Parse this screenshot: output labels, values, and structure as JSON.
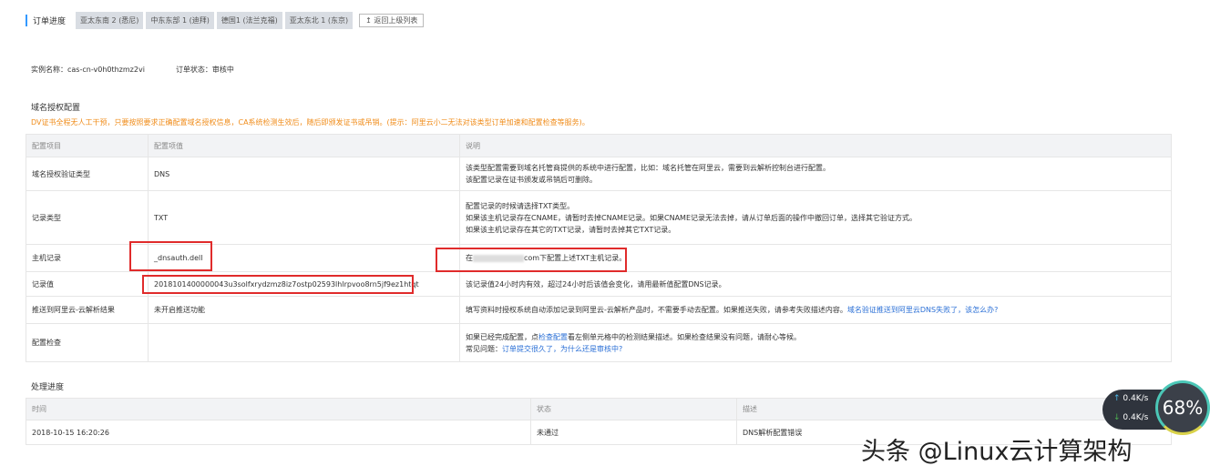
{
  "tabs": {
    "title": "订单进度",
    "items": [
      "亚太东南 2 (悉尼)",
      "中东东部 1 (迪拜)",
      "德国1 (法兰克福)",
      "亚太东北 1 (东京)"
    ],
    "back": "↥ 返回上级列表"
  },
  "instance": {
    "name": "实例名称：cas-cn-v0h0thzmz2vi",
    "status": "订单状态：审核中"
  },
  "domain_auth": {
    "title": "域名授权配置",
    "warning": "DV证书全程无人工干预，只要按照要求正确配置域名授权信息，CA系统检测生效后，随后即颁发证书或吊销。(提示：阿里云小二无法对该类型订单加速和配置检查等服务)。",
    "headers": [
      "配置项目",
      "配置项值",
      "说明"
    ],
    "rows": [
      {
        "item": "域名授权验证类型",
        "value": "DNS",
        "desc": [
          "该类型配置需要到域名托管商提供的系统中进行配置，比如：域名托管在阿里云，需要到云解析控制台进行配置。",
          "该配置记录在证书颁发或吊销后可删除。"
        ]
      },
      {
        "item": "记录类型",
        "value": "TXT",
        "desc": [
          "配置记录的时候请选择TXT类型。",
          "如果该主机记录存在CNAME，请暂时去掉CNAME记录。如果CNAME记录无法去掉，请从订单后面的操作中撤回订单，选择其它验证方式。",
          "如果该主机记录存在其它的TXT记录，请暂时去掉其它TXT记录。"
        ]
      },
      {
        "item": "主机记录",
        "value": "_dnsauth.dell",
        "desc_pre": "在",
        "desc_post": "com下配置上述TXT主机记录。"
      },
      {
        "item": "记录值",
        "value": "2018101400000043u3solfxrydzmz8iz7ostp02593lhlrpvoo8rn5jf9ez1htqt",
        "desc": [
          "该记录值24小时内有效，超过24小时后该值会变化，请用最新值配置DNS记录。"
        ]
      },
      {
        "item": "推送到阿里云-云解析结果",
        "value": "未开启推送功能",
        "desc_text": "填写资料时授权系统自动添加记录到阿里云-云解析产品时，不需要手动去配置。如果推送失败，请参考失败描述内容。",
        "desc_link": "域名验证推送到阿里云DNS失败了，该怎么办?"
      },
      {
        "item": "配置检查",
        "value": "",
        "l1_pre": "如果已经完成配置，点",
        "l1_link": "检查配置",
        "l1_post": "看左侧单元格中的检测结果描述。如果检查结果没有问题，请耐心等候。",
        "l2_pre": "常见问题：",
        "l2_link": "订单提交很久了，为什么还是审核中?"
      }
    ]
  },
  "progress": {
    "title": "处理进度",
    "headers": [
      "时间",
      "状态",
      "描述"
    ],
    "rows": [
      {
        "time": "2018-10-15 16:20:26",
        "status": "未通过",
        "desc": "DNS解析配置错误"
      }
    ]
  },
  "overlay": {
    "up": "0.4K/s",
    "down": "0.4K/s",
    "percent": "68%",
    "watermark": "头条 @Linux云计算架构"
  }
}
